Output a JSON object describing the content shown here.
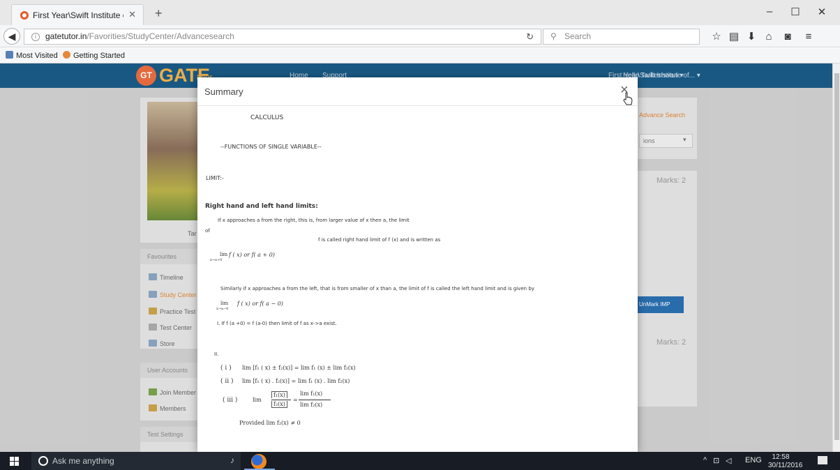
{
  "browser": {
    "tab_title": "First Year\\Swift Institute of...",
    "tab_close": "✕",
    "new_tab": "+",
    "url_host": "gatetutor.in",
    "url_path": "/Favorities/StudyCenter/Advancesearch",
    "search_placeholder": "Search",
    "window_minimize": "–",
    "window_maximize": "☐",
    "window_close": "✕",
    "bookmarks": [
      "Most Visited",
      "Getting Started"
    ]
  },
  "site": {
    "logo_badge": "GT",
    "logo_text": "GATE",
    "logo_sub": "tutor",
    "nav": [
      "Home",
      "Support"
    ],
    "institute_menu": "First Year\\Swift Institute of... ▾",
    "user_menu": "Hello Tarkeshwari ▾",
    "advance_search": "Advance Search",
    "select_value": "ions",
    "marks_1": "Marks: 2",
    "marks_2": "Marks: 2",
    "unmark_button": "UnMark IMP",
    "profile_name": "Tar",
    "favourites_head": "Favourites",
    "sidebar_links": [
      "Timeline",
      "Study Center",
      "Practice Test",
      "Test Center",
      "Store"
    ],
    "user_accounts_head": "User Accounts",
    "user_links": [
      "Join Member",
      "Members"
    ],
    "test_settings_head": "Test Settings"
  },
  "modal": {
    "title": "Summary",
    "close": "×",
    "heading": "CALCULUS",
    "subheading": "--FUNCTIONS OF SINGLE VARIABLE--",
    "limit": "LIMIT:-",
    "section": "Right hand and left hand limits:",
    "p1": "If x approaches a from the right, this is, from larger value of x then a, the limit",
    "p1_of": "of",
    "p1b": "f is called right hand limit of f (x) and is written as",
    "rhl_lim": "lim",
    "rhl_sub": "x→a+0",
    "rhl_expr": "f ( x) or f( a + 0)",
    "p2": "Similarly if x approaches a from the left, that is from smaller of x than a, the limit of f is called the left hand limit and is given by",
    "lhl_lim": "lim",
    "lhl_sub": "x→a−0",
    "lhl_expr": "f ( x) or f( a − 0)",
    "rule1": "I. If f (a +0) = f (a-0) then limit of f as x->a exist.",
    "rule2": "II.",
    "f1_idx": "( i )",
    "f1": "lim [f₁ ( x) ± f₂(x)] = lim f₁ (x) ± lim f₂(x)",
    "f2_idx": "( ii )",
    "f2": "lim [f₁ ( x) . f₂(x)] = lim f₁ (x) . lim f₂(x)",
    "f3_idx": "( iii )",
    "f3_lim": "lim",
    "f3_num": "f₁(x)",
    "f3_den": "f₂(x)",
    "f3_eq": "=",
    "f3_rnum": "lim f₁(x)",
    "f3_rden": "lim f₂(x)",
    "provided": "Provided lim f₂(x) ≠ 0"
  },
  "taskbar": {
    "search_text": "Ask me anything",
    "language": "ENG",
    "time": "12:58",
    "date": "30/11/2016"
  }
}
